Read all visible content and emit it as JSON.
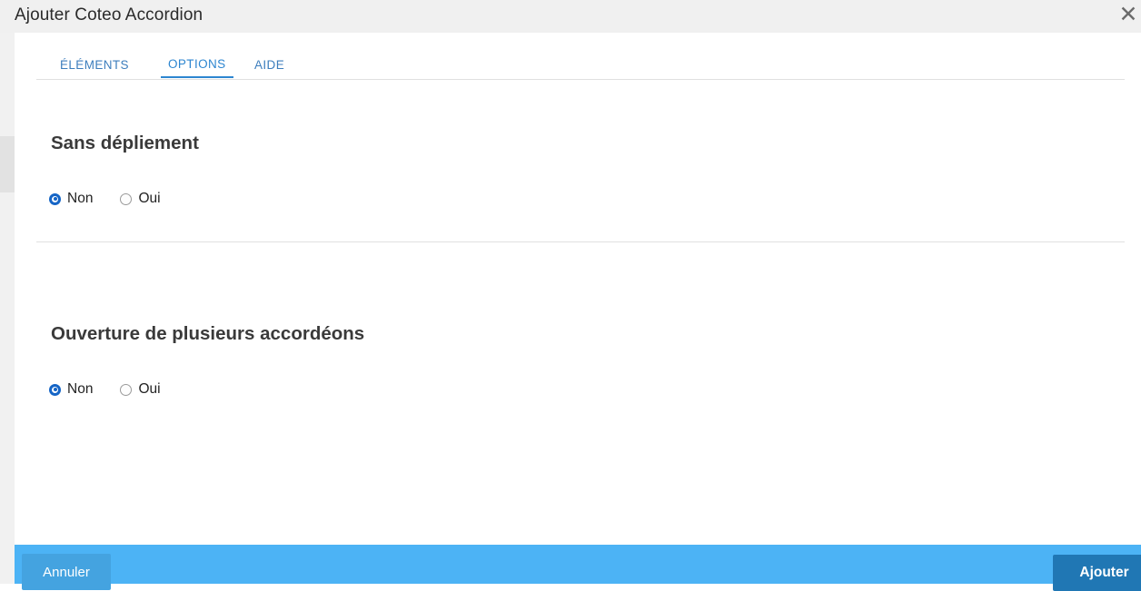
{
  "window": {
    "title": "Ajouter Coteo Accordion",
    "close_icon": "close-icon",
    "close_glyph": "✕"
  },
  "tabs": [
    {
      "label": "ÉLÉMENTS",
      "active": false
    },
    {
      "label": "OPTIONS",
      "active": true
    },
    {
      "label": "AIDE",
      "active": false
    }
  ],
  "sections": [
    {
      "title": "Sans dépliement",
      "options": [
        {
          "label": "Non",
          "selected": true
        },
        {
          "label": "Oui",
          "selected": false
        }
      ]
    },
    {
      "title": "Ouverture de plusieurs accordéons",
      "options": [
        {
          "label": "Non",
          "selected": true
        },
        {
          "label": "Oui",
          "selected": false
        }
      ]
    }
  ],
  "footer": {
    "cancel_label": "Annuler",
    "submit_label": "Ajouter"
  },
  "colors": {
    "accent": "#2d86d0",
    "footer_bar": "#4cb3f5",
    "cancel_button": "#44a3e0",
    "submit_button": "#2077b4",
    "titlebar": "#f0f0f0",
    "radio_selected": "#1565c6"
  }
}
